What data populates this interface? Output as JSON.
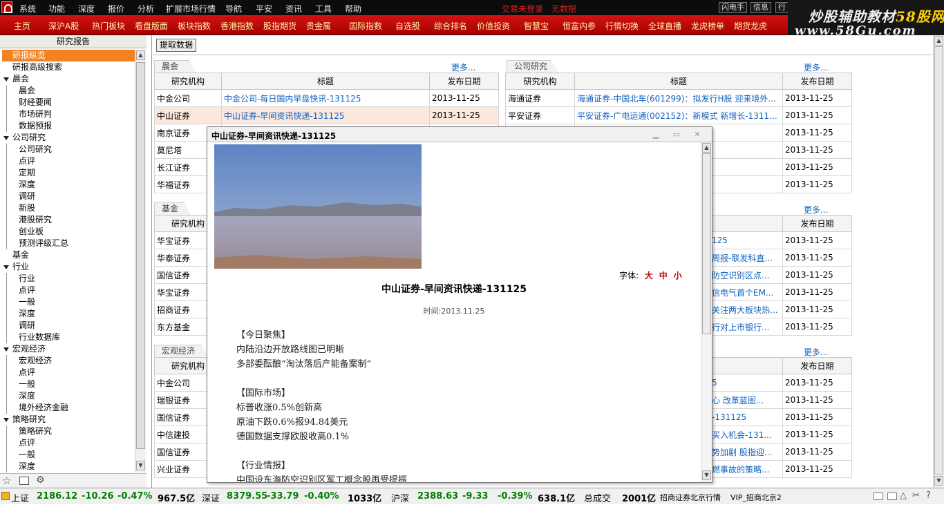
{
  "menubar": {
    "items": [
      "系统",
      "功能",
      "深度",
      "报价",
      "分析",
      "扩展市场行情",
      "导航",
      "平安",
      "资讯",
      "工具",
      "帮助"
    ],
    "red_items": [
      "交易未登录",
      "无数据"
    ],
    "right_buttons": [
      "闪电手",
      "信息",
      "行"
    ]
  },
  "tabbar": {
    "tabs": [
      "主页",
      "深沪A股",
      "热门板块",
      "看盘版面",
      "板块指数",
      "香港指数",
      "股指期货",
      "贵金属",
      "国际指数",
      "自选股",
      "综合排名",
      "价值投资",
      "智慧宝",
      "恒富内参",
      "行情切换",
      "全球直播",
      "龙虎榜单",
      "期货龙虎"
    ]
  },
  "brand": {
    "line1_a": "炒股辅助教材",
    "line1_b": "58股网",
    "line2": "www.58Gu.com"
  },
  "left_panel": {
    "title": "研究报告",
    "tree": [
      {
        "label": "研报纵览",
        "level": 0,
        "selected": true
      },
      {
        "label": "研报高级搜索",
        "level": 0
      },
      {
        "label": "晨会",
        "level": 0,
        "expanded": true
      },
      {
        "label": "晨会",
        "level": 1
      },
      {
        "label": "财经要闻",
        "level": 1
      },
      {
        "label": "市场研判",
        "level": 1
      },
      {
        "label": "数据预报",
        "level": 1
      },
      {
        "label": "公司研究",
        "level": 0,
        "expanded": true
      },
      {
        "label": "公司研究",
        "level": 1
      },
      {
        "label": "点评",
        "level": 1
      },
      {
        "label": "定期",
        "level": 1
      },
      {
        "label": "深度",
        "level": 1
      },
      {
        "label": "调研",
        "level": 1
      },
      {
        "label": "新股",
        "level": 1
      },
      {
        "label": "港股研究",
        "level": 1
      },
      {
        "label": "创业板",
        "level": 1
      },
      {
        "label": "预测评级汇总",
        "level": 1
      },
      {
        "label": "基金",
        "level": 0
      },
      {
        "label": "行业",
        "level": 0,
        "expanded": true
      },
      {
        "label": "行业",
        "level": 1
      },
      {
        "label": "点评",
        "level": 1
      },
      {
        "label": "一般",
        "level": 1
      },
      {
        "label": "深度",
        "level": 1
      },
      {
        "label": "调研",
        "level": 1
      },
      {
        "label": "行业数据库",
        "level": 1
      },
      {
        "label": "宏观经济",
        "level": 0,
        "expanded": true
      },
      {
        "label": "宏观经济",
        "level": 1
      },
      {
        "label": "点评",
        "level": 1
      },
      {
        "label": "一般",
        "level": 1
      },
      {
        "label": "深度",
        "level": 1
      },
      {
        "label": "境外经济金融",
        "level": 1
      },
      {
        "label": "策略研究",
        "level": 0,
        "expanded": true
      },
      {
        "label": "策略研究",
        "level": 1
      },
      {
        "label": "点评",
        "level": 1
      },
      {
        "label": "一般",
        "level": 1
      },
      {
        "label": "深度",
        "level": 1
      }
    ]
  },
  "main": {
    "fetch_button": "提取数据",
    "more_label": "更多...",
    "headers": {
      "org": "研究机构",
      "title": "标题",
      "date": "发布日期"
    },
    "sections": {
      "morning": {
        "tab": "晨会",
        "rows": [
          {
            "org": "中金公司",
            "title": "中金公司-每日国内早盘快讯-131125",
            "date": "2013-11-25"
          },
          {
            "org": "中山证券",
            "title": "中山证券-早间资讯快递-131125",
            "date": "2013-11-25"
          },
          {
            "org": "南京证券",
            "title": "",
            "date": ""
          },
          {
            "org": "莫尼塔",
            "title": "",
            "date": ""
          },
          {
            "org": "长江证券",
            "title": "",
            "date": ""
          },
          {
            "org": "华福证券",
            "title": "",
            "date": ""
          }
        ]
      },
      "company": {
        "tab": "公司研究",
        "rows": [
          {
            "org": "海通证券",
            "title": "海通证券-中国北车(601299)：拟发行H股 迎来境外...",
            "date": "2013-11-25"
          },
          {
            "org": "平安证券",
            "title": "平安证券-广电运通(002152)：新模式 新增长-1311...",
            "date": "2013-11-25"
          },
          {
            "org": "",
            "title": "国上市公司 延...",
            "date": "2013-11-25"
          },
          {
            "org": "",
            "title": "拔增持4.99%...",
            "date": "2013-11-25"
          },
          {
            "org": "",
            "title": "越级豪华 注...",
            "date": "2013-11-25"
          },
          {
            "org": "",
            "title": "力较快增长 客...",
            "date": "2013-11-25"
          }
        ]
      },
      "fund": {
        "tab": "基金",
        "rows": [
          {
            "org": "华宝证券",
            "title": "",
            "date": ""
          },
          {
            "org": "华泰证券",
            "title": "",
            "date": ""
          },
          {
            "org": "国信证券",
            "title": "",
            "date": ""
          },
          {
            "org": "华宝证券",
            "title": "",
            "date": ""
          },
          {
            "org": "招商证券",
            "title": "",
            "date": ""
          },
          {
            "org": "东方基金",
            "title": "",
            "date": ""
          }
        ]
      },
      "industry": {
        "rows": [
          {
            "title": "125",
            "date": "2013-11-25"
          },
          {
            "title": "周报-联发科直...",
            "date": "2013-11-25"
          },
          {
            "title": "防空识别区点...",
            "date": "2013-11-25"
          },
          {
            "title": "信电气首个EM...",
            "date": "2013-11-25"
          },
          {
            "title": "关注两大板块热...",
            "date": "2013-11-25"
          },
          {
            "title": "行对上市银行...",
            "date": "2013-11-25"
          }
        ]
      },
      "macro": {
        "tab": "宏观经济",
        "rows": [
          {
            "org": "中金公司",
            "title": "",
            "date": ""
          },
          {
            "org": "瑞银证券",
            "title": "",
            "date": ""
          },
          {
            "org": "国信证券",
            "title": "",
            "date": ""
          },
          {
            "org": "中信建投",
            "title": "",
            "date": ""
          },
          {
            "org": "国信证券",
            "title": "",
            "date": ""
          },
          {
            "org": "兴业证券",
            "title": "",
            "date": ""
          }
        ]
      },
      "strategy": {
        "rows": [
          {
            "title": "5",
            "date": "2013-11-25"
          },
          {
            "title": "心 改革蓝图...",
            "date": "2013-11-25"
          },
          {
            "title": "-131125",
            "date": "2013-11-25"
          },
          {
            "title": "买入机会-131...",
            "date": "2013-11-25"
          },
          {
            "title": "势加剧 股指迎...",
            "date": "2013-11-25"
          },
          {
            "title": "燃事故的策略...",
            "date": "2013-11-25"
          }
        ]
      }
    }
  },
  "popup": {
    "window_title": "中山证券-早间资讯快递-131125",
    "font_label": "字体:",
    "font_sizes": [
      "大",
      "中",
      "小"
    ],
    "article_title": "中山证券-早间资讯快递-131125",
    "article_time": "时间:2013.11.25",
    "content": [
      "【今日聚焦】",
      "内陆沿边开放路线图已明晰",
      "多部委酝酿“淘汰落后产能备案制”",
      "",
      "【国际市场】",
      "标普收涨0.5%创新高",
      "原油下跌0.6%报94.84美元",
      "德国数据支撑欧股收高0.1%",
      "",
      "【行业情报】",
      "中国设东海防空识别区军工概念股再受提振"
    ]
  },
  "status": {
    "sh": {
      "name": "上证",
      "price": "2186.12",
      "chg": "-10.26",
      "pct": "-0.47%",
      "amt": "967.5亿"
    },
    "sz": {
      "name": "深证",
      "price": "8379.55",
      "chg": "-33.79",
      "pct": "-0.40%",
      "amt": "1033亿"
    },
    "hs": {
      "name": "沪深",
      "price": "2388.63",
      "chg": "-9.33",
      "pct": "-0.39%",
      "amt": "638.1亿"
    },
    "total_label": "总成交",
    "total": "2001亿",
    "broker": "招商证券北京行情",
    "server": "VIP_招商北京2"
  },
  "colors": {
    "accent": "#f58220",
    "tab_red": "#c00000",
    "link": "#1060c0",
    "down": "#008000"
  }
}
